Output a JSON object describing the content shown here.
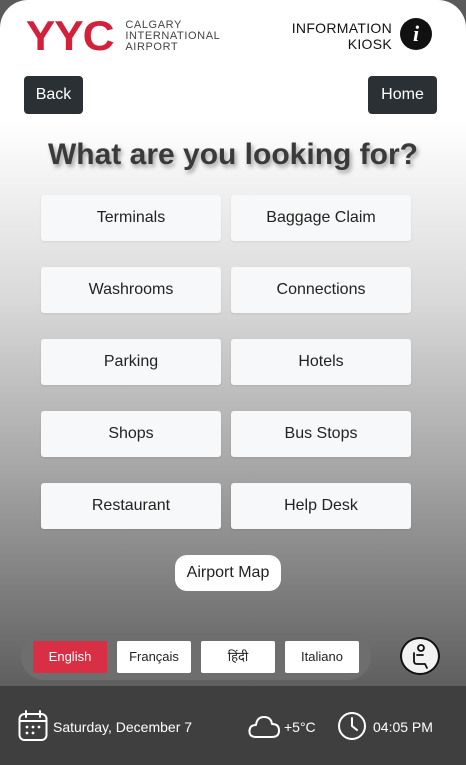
{
  "header": {
    "logo_mark": "YYC",
    "logo_lines": [
      "CALGARY",
      "INTERNATIONAL",
      "AIRPORT"
    ],
    "kiosk_line1": "INFORMATION",
    "kiosk_line2": "KIOSK",
    "info_icon_glyph": "i"
  },
  "nav": {
    "back_label": "Back",
    "home_label": "Home"
  },
  "title": "What are you looking for?",
  "tiles": [
    "Terminals",
    "Baggage Claim",
    "Washrooms",
    "Connections",
    "Parking",
    "Hotels",
    "Shops",
    "Bus Stops",
    "Restaurant",
    "Help Desk"
  ],
  "airport_map_label": "Airport Map",
  "languages": {
    "items": [
      "English",
      "Français",
      "हिंदी",
      "Italiano"
    ],
    "active": "English"
  },
  "footer": {
    "date": "Saturday, December 7",
    "temperature": "+5°C",
    "time": "04:05 PM"
  },
  "colors": {
    "brand_red": "#d4203a",
    "active_language": "#d92f45",
    "nav_button": "#2b3035",
    "footer_bg": "#3f3f3f"
  },
  "icons": [
    "info-icon",
    "calendar-icon",
    "cloud-icon",
    "clock-icon",
    "accessibility-icon"
  ]
}
